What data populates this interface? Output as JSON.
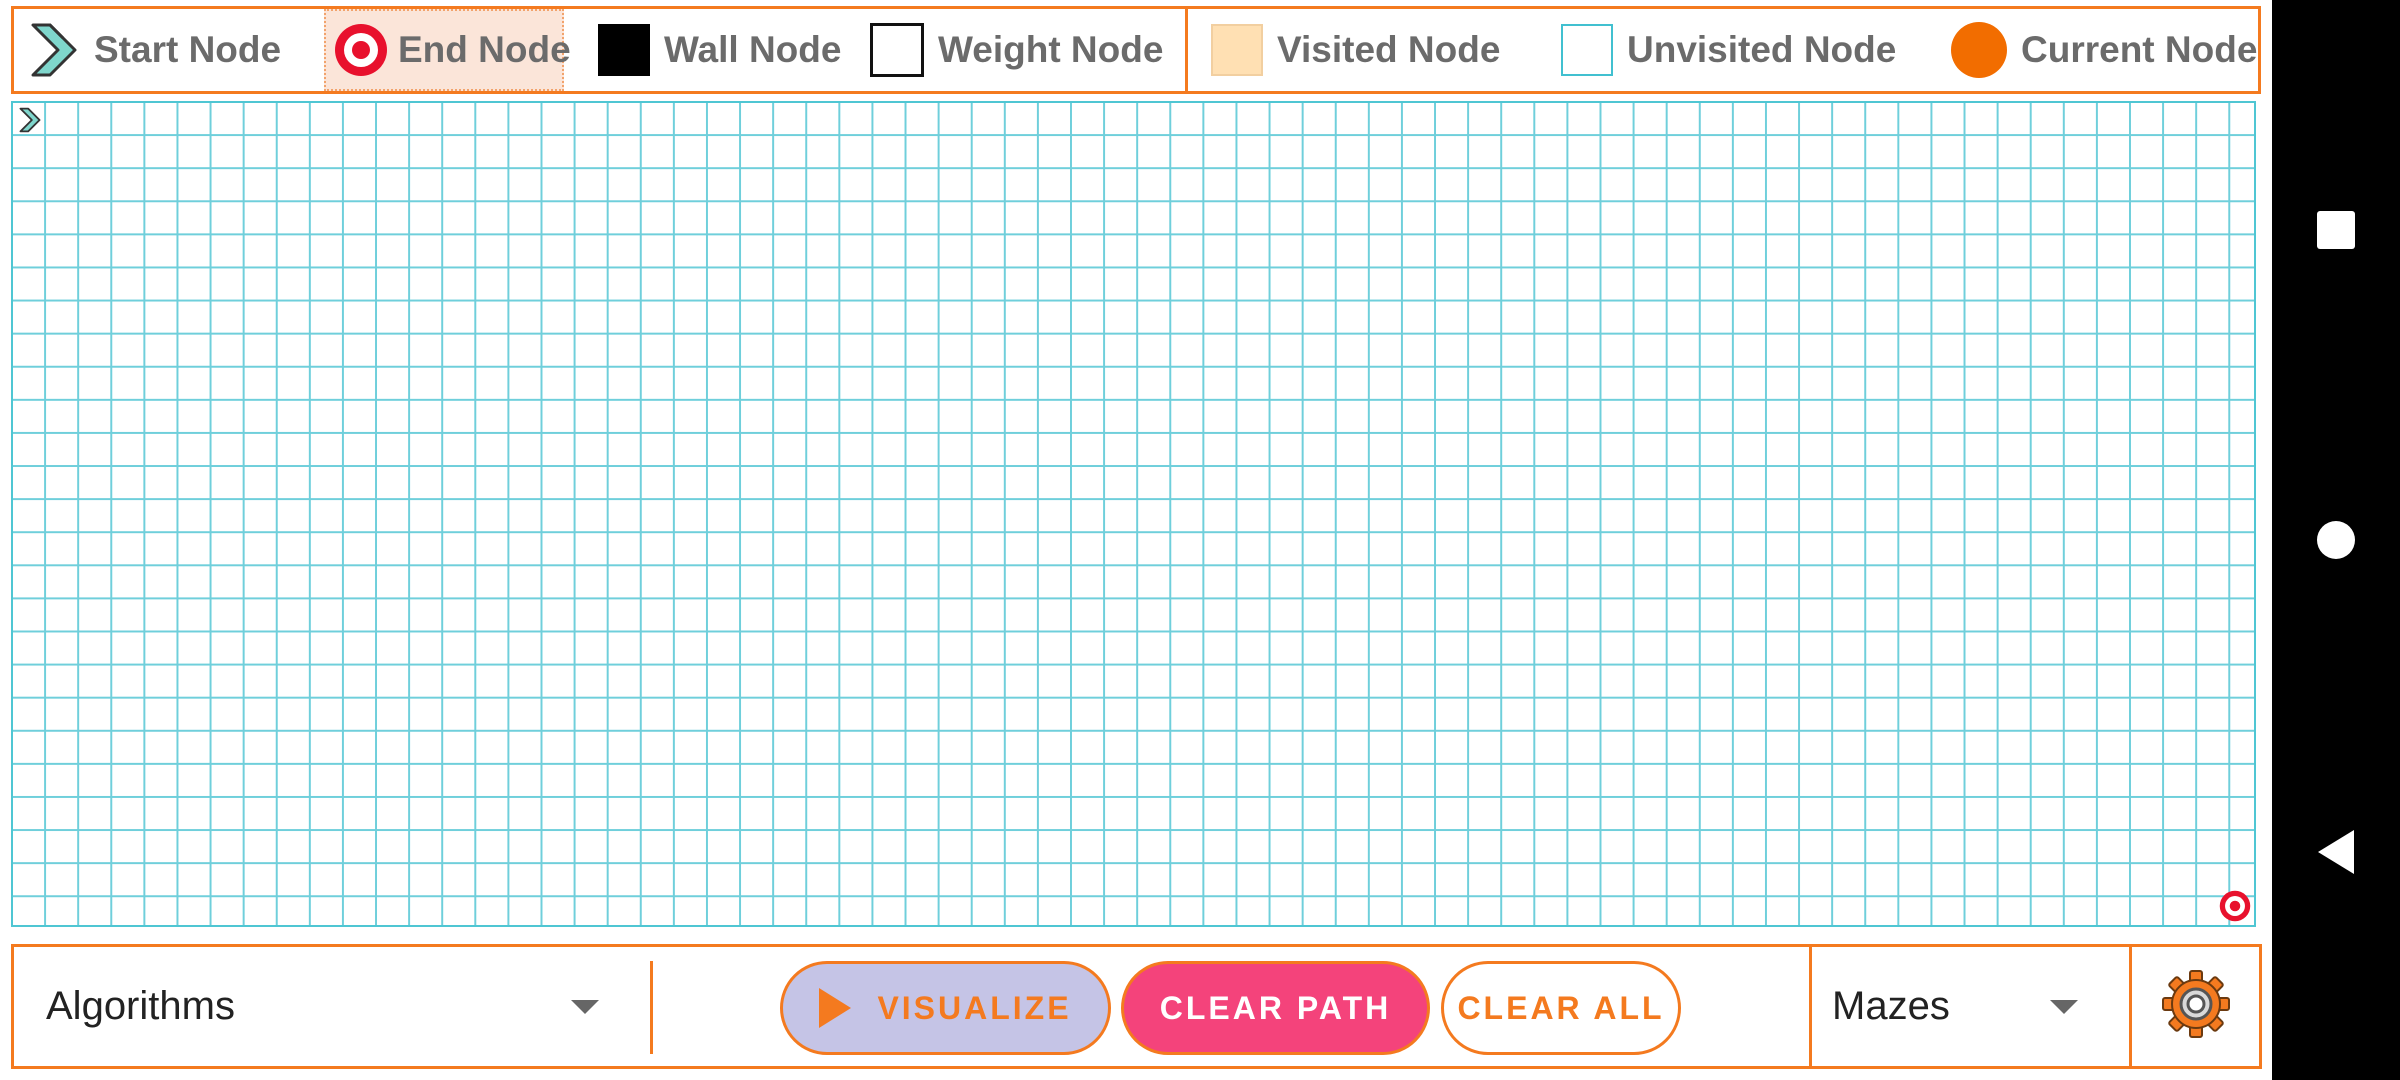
{
  "legend": {
    "start_node": "Start Node",
    "end_node": "End Node",
    "wall_node": "Wall Node",
    "weight_node": "Weight Node",
    "visited_node": "Visited Node",
    "unvisited_node": "Unvisited Node",
    "current_node": "Current Node",
    "selected_item": "End Node"
  },
  "controls": {
    "algorithms_dropdown": "Algorithms",
    "visualize_label": "VISUALIZE",
    "clear_path_label": "CLEAR PATH",
    "clear_all_label": "CLEAR ALL",
    "mazes_dropdown": "Mazes"
  },
  "colors": {
    "accent": "#f47a1f",
    "grid_line": "#6fcfdb",
    "start_node": "#7fd6cc",
    "end_node": "#e8112d",
    "visited": "#ffe0b3",
    "current": "#f26d00",
    "clear_path_bg": "#f4437b",
    "visualize_bg": "#c5c4e6"
  },
  "icons": {
    "start": "start-node-icon",
    "end": "target-icon",
    "settings": "gear-icon",
    "nav": [
      "recents-square-icon",
      "home-circle-icon",
      "back-triangle-icon"
    ]
  }
}
